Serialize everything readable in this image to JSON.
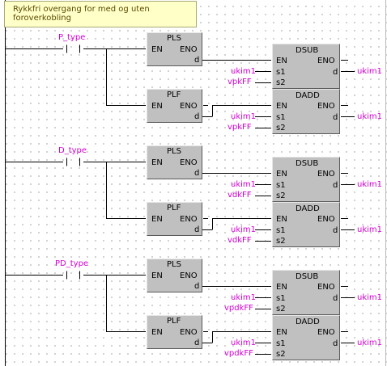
{
  "comment": {
    "line1": "Rykkfri overgang for med og uten",
    "line2": "foroverkobling"
  },
  "pin_labels": {
    "en": "EN",
    "eno": "ENO",
    "d": "d",
    "s1": "s1",
    "s2": "s2"
  },
  "colors": {
    "variable": "#d400d4",
    "block_fill": "#c0c0c0",
    "comment_fill": "#ffffc8",
    "grid_dot": "#a9a9a9"
  },
  "rungs": [
    {
      "contact": "P_type",
      "pls": "PLS",
      "plf": "PLF",
      "sub": {
        "name": "DSUB",
        "s1": "ukim1",
        "s2": "vpkFF",
        "d": "ukim1"
      },
      "add": {
        "name": "DADD",
        "s1": "ukim1",
        "s2": "vpkFF",
        "d": "ukim1"
      }
    },
    {
      "contact": "D_type",
      "pls": "PLS",
      "plf": "PLF",
      "sub": {
        "name": "DSUB",
        "s1": "ukim1",
        "s2": "vdkFF",
        "d": "ukim1"
      },
      "add": {
        "name": "DADD",
        "s1": "ukim1",
        "s2": "vdkFF",
        "d": "ukim1"
      }
    },
    {
      "contact": "PD_type",
      "pls": "PLS",
      "plf": "PLF",
      "sub": {
        "name": "DSUB",
        "s1": "ukim1",
        "s2": "vpdkFF",
        "d": "ukim1"
      },
      "add": {
        "name": "DADD",
        "s1": "ukim1",
        "s2": "vpdkFF",
        "d": "ukim1"
      }
    }
  ]
}
